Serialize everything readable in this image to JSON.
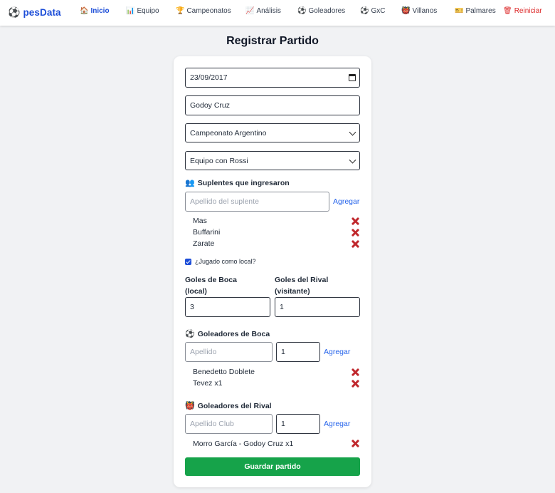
{
  "nav": {
    "brand": "pesData",
    "brand_icon": "soccer-ball-icon",
    "items": [
      {
        "label": "Inicio",
        "icon": "🏠"
      },
      {
        "label": "Equipo",
        "icon": "📊"
      },
      {
        "label": "Campeonatos",
        "icon": "🏆"
      },
      {
        "label": "Análisis",
        "icon": "📈"
      },
      {
        "label": "Goleadores",
        "icon": "⚽"
      },
      {
        "label": "GxC",
        "icon": "⚽"
      },
      {
        "label": "Villanos",
        "icon": "👹"
      },
      {
        "label": "Palmares",
        "icon": "🎫"
      },
      {
        "label": "Reiniciar",
        "icon": "🗑"
      }
    ]
  },
  "page": {
    "title": "Registrar Partido"
  },
  "form": {
    "date": "23/09/2017",
    "rival": "Godoy Cruz",
    "competition": "Campeonato Argentino",
    "team": "Equipo con Rossi",
    "subs": {
      "title": "Suplentes que ingresaron",
      "icon": "👥",
      "placeholder": "Apellido del suplente",
      "add_label": "Agregar",
      "items": [
        "Mas",
        "Buffarini",
        "Zarate"
      ]
    },
    "local": {
      "label": "¿Jugado como local?",
      "checked": true
    },
    "goals": {
      "home_label_1": "Goles de Boca",
      "home_label_2": "(local)",
      "away_label_1": "Goles del Rival",
      "away_label_2": "(visitante)",
      "home": "3",
      "away": "1"
    },
    "boca_scorers": {
      "title": "Goleadores de Boca",
      "icon": "⚽",
      "placeholder": "Apellido",
      "count": "1",
      "add_label": "Agregar",
      "items": [
        "Benedetto Doblete",
        "Tevez x1"
      ]
    },
    "rival_scorers": {
      "title": "Goleadores del Rival",
      "icon": "👹",
      "placeholder": "Apellido Club",
      "count": "1",
      "add_label": "Agregar",
      "items": [
        "Morro García - Godoy Cruz x1"
      ]
    },
    "save_label": "Guardar partido"
  },
  "colors": {
    "primary": "#1d4ed8",
    "success": "#16a34a",
    "danger": "#dc2626",
    "link": "#2563eb"
  }
}
